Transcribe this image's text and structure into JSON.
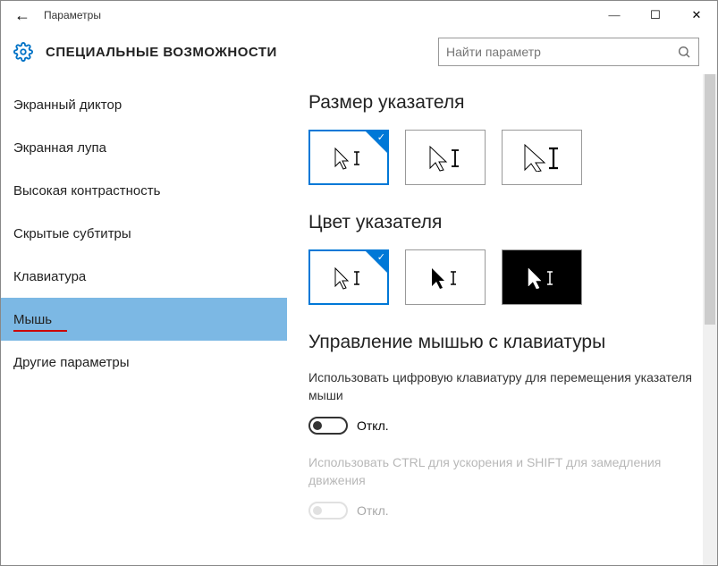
{
  "window": {
    "title": "Параметры"
  },
  "header": {
    "title": "СПЕЦИАЛЬНЫЕ ВОЗМОЖНОСТИ",
    "search_placeholder": "Найти параметр"
  },
  "sidebar": {
    "items": [
      {
        "label": "Экранный диктор"
      },
      {
        "label": "Экранная лупа"
      },
      {
        "label": "Высокая контрастность"
      },
      {
        "label": "Скрытые субтитры"
      },
      {
        "label": "Клавиатура"
      },
      {
        "label": "Мышь"
      },
      {
        "label": "Другие параметры"
      }
    ]
  },
  "content": {
    "size_heading": "Размер указателя",
    "color_heading": "Цвет указателя",
    "keys_heading": "Управление мышью с клавиатуры",
    "keys_desc": "Использовать цифровую клавиатуру для перемещения указателя мыши",
    "off": "Откл.",
    "ctrl_desc": "Использовать CTRL для ускорения и SHIFT для замедления движения",
    "off2": "Откл."
  }
}
